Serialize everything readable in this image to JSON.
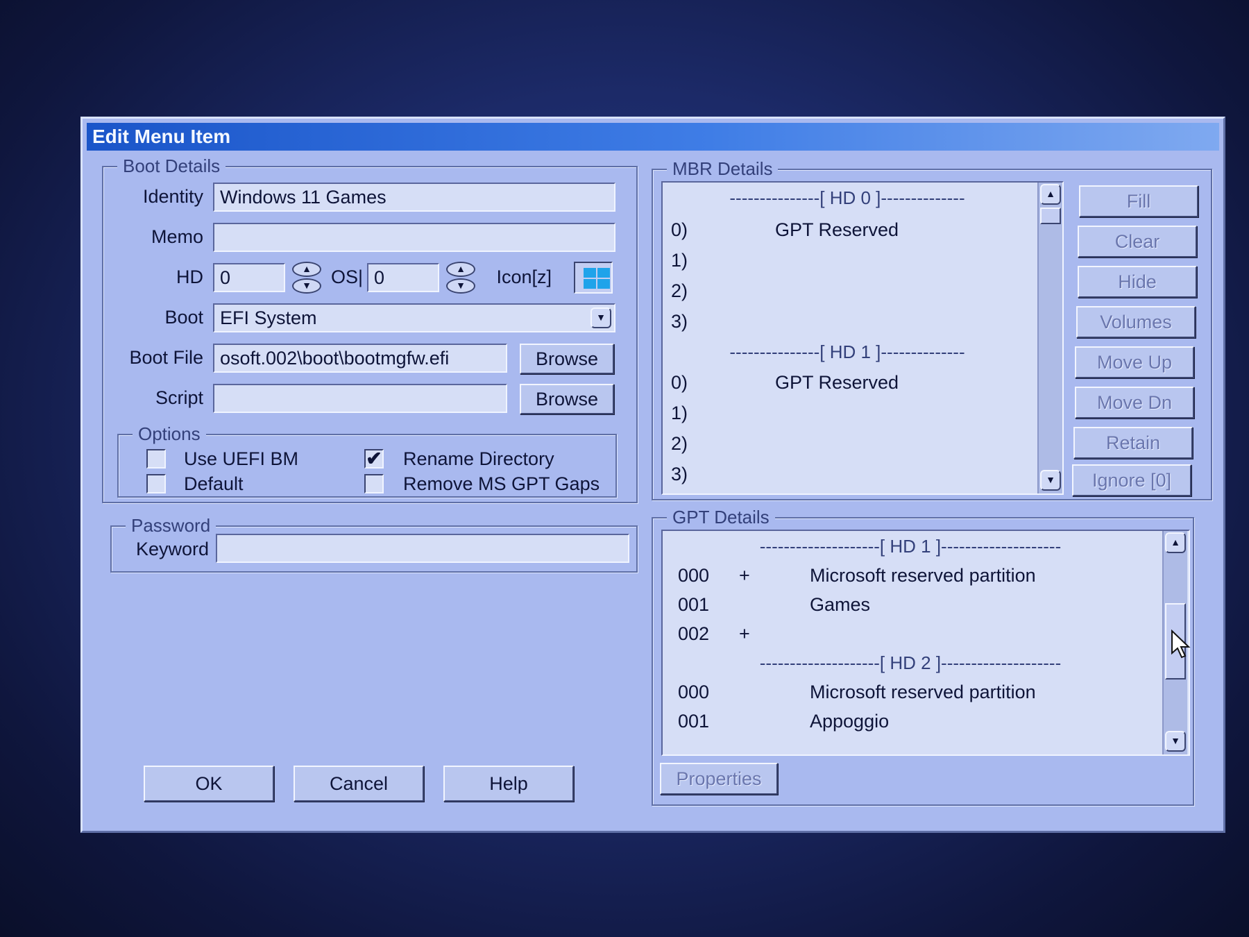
{
  "window": {
    "title": "Edit Menu Item"
  },
  "boot_details": {
    "legend": "Boot Details",
    "identity_label": "Identity",
    "identity_value": "Windows 11 Games",
    "memo_label": "Memo",
    "memo_value": "",
    "hd_label": "HD",
    "hd_value": "0",
    "os_label": "OS|",
    "os_value": "0",
    "icon_label": "Icon[z]",
    "boot_label": "Boot",
    "boot_value": "EFI System",
    "boot_file_label": "Boot File",
    "boot_file_value": "osoft.002\\boot\\bootmgfw.efi",
    "browse_label": "Browse",
    "script_label": "Script",
    "script_value": "",
    "browse2_label": "Browse"
  },
  "options": {
    "legend": "Options",
    "items": [
      {
        "label": "Use UEFI BM",
        "checked": false
      },
      {
        "label": "Default",
        "checked": false
      },
      {
        "label": "Rename Directory",
        "checked": true
      },
      {
        "label": "Remove MS GPT Gaps",
        "checked": false
      }
    ],
    "check_mark": "✔"
  },
  "password": {
    "legend": "Password",
    "keyword_label": "Keyword",
    "keyword_value": ""
  },
  "footer": {
    "ok": "OK",
    "cancel": "Cancel",
    "help": "Help"
  },
  "mbr_details": {
    "legend": "MBR Details",
    "rows": [
      {
        "sep": "---------------[ HD 0 ]--------------"
      },
      {
        "idx": "0)",
        "name": "GPT Reserved"
      },
      {
        "idx": "1)",
        "name": ""
      },
      {
        "idx": "2)",
        "name": ""
      },
      {
        "idx": "3)",
        "name": ""
      },
      {
        "sep": "---------------[ HD 1 ]--------------"
      },
      {
        "idx": "0)",
        "name": "GPT Reserved"
      },
      {
        "idx": "1)",
        "name": ""
      },
      {
        "idx": "2)",
        "name": ""
      },
      {
        "idx": "3)",
        "name": ""
      }
    ],
    "buttons": [
      "Fill",
      "Clear",
      "Hide",
      "Volumes",
      "Move Up",
      "Move Dn",
      "Retain",
      "Ignore [0]"
    ]
  },
  "gpt_details": {
    "legend": "GPT Details",
    "rows": [
      {
        "sep": "--------------------[ HD 1 ]--------------------"
      },
      {
        "num": "000",
        "flag": "+",
        "name": "Microsoft reserved partition"
      },
      {
        "num": "001",
        "flag": "",
        "name": "Games"
      },
      {
        "num": "002",
        "flag": "+",
        "name": ""
      },
      {
        "sep": "--------------------[ HD 2 ]--------------------"
      },
      {
        "num": "000",
        "flag": "",
        "name": "Microsoft reserved partition"
      },
      {
        "num": "001",
        "flag": "",
        "name": "Appoggio"
      }
    ],
    "properties_label": "Properties"
  },
  "colors": {
    "dialog_bg": "#a9b9ef",
    "title_bar": "#1a55c9",
    "field_bg": "#d6def6",
    "icon_blue": "#1fa3ea"
  },
  "icons": {
    "spinner": "spinner-icon",
    "os": "windows-logo-icon",
    "dropdown": "chevron-down-icon"
  }
}
